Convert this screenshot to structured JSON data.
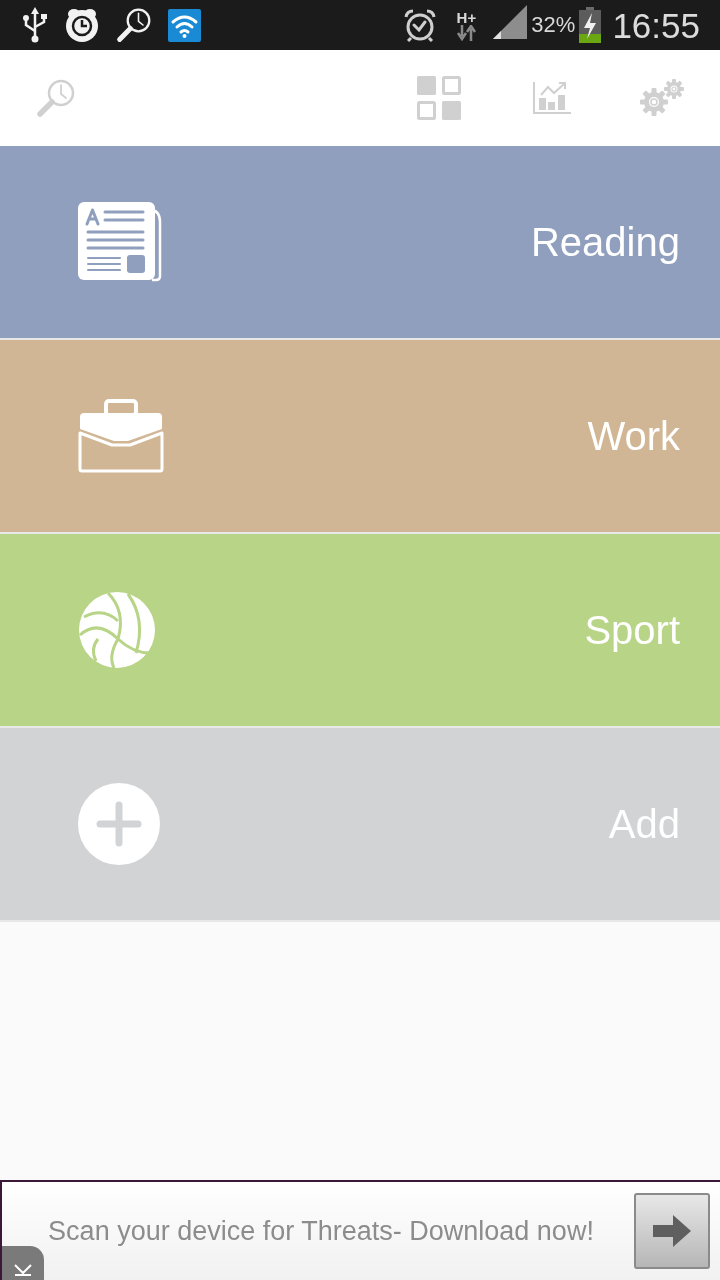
{
  "status_bar": {
    "network_type": "H+",
    "battery_percent": "32%",
    "time": "16:55"
  },
  "categories": [
    {
      "kind": "category",
      "label": "Reading",
      "color": "#8f9fbd"
    },
    {
      "kind": "category",
      "label": "Work",
      "color": "#d0b694"
    },
    {
      "kind": "category",
      "label": "Sport",
      "color": "#b8d486"
    },
    {
      "kind": "add",
      "label": "Add",
      "color": "#d2d3d5"
    }
  ],
  "ad_banner": {
    "text": "Scan your device for Threats- Download now!"
  }
}
